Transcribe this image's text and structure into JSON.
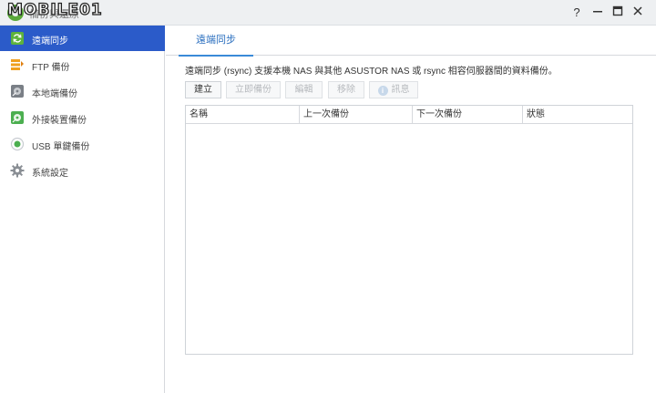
{
  "window": {
    "title": "備份與還原",
    "watermark": "MOBILE01"
  },
  "sidebar": {
    "items": [
      {
        "label": "遠端同步",
        "icon": "sync-icon",
        "active": true
      },
      {
        "label": "FTP 備份",
        "icon": "ftp-server-icon"
      },
      {
        "label": "本地端備份",
        "icon": "local-disk-icon"
      },
      {
        "label": "外接裝置備份",
        "icon": "external-device-icon"
      },
      {
        "label": "USB 單鍵備份",
        "icon": "usb-button-icon"
      },
      {
        "label": "系統設定",
        "icon": "gear-icon"
      }
    ]
  },
  "main": {
    "tab": "遠端同步",
    "description": "遠端同步 (rsync) 支援本機 NAS 與其他 ASUSTOR NAS 或 rsync 相容伺服器間的資料備份。",
    "toolbar": {
      "create": "建立",
      "backup_now": "立即備份",
      "edit": "編輯",
      "remove": "移除",
      "info": "訊息"
    },
    "table": {
      "columns": [
        "名稱",
        "上一次備份",
        "下一次備份",
        "狀態"
      ]
    }
  },
  "colors": {
    "accent": "#2b5bc9",
    "tab_accent": "#3a8ad8"
  }
}
